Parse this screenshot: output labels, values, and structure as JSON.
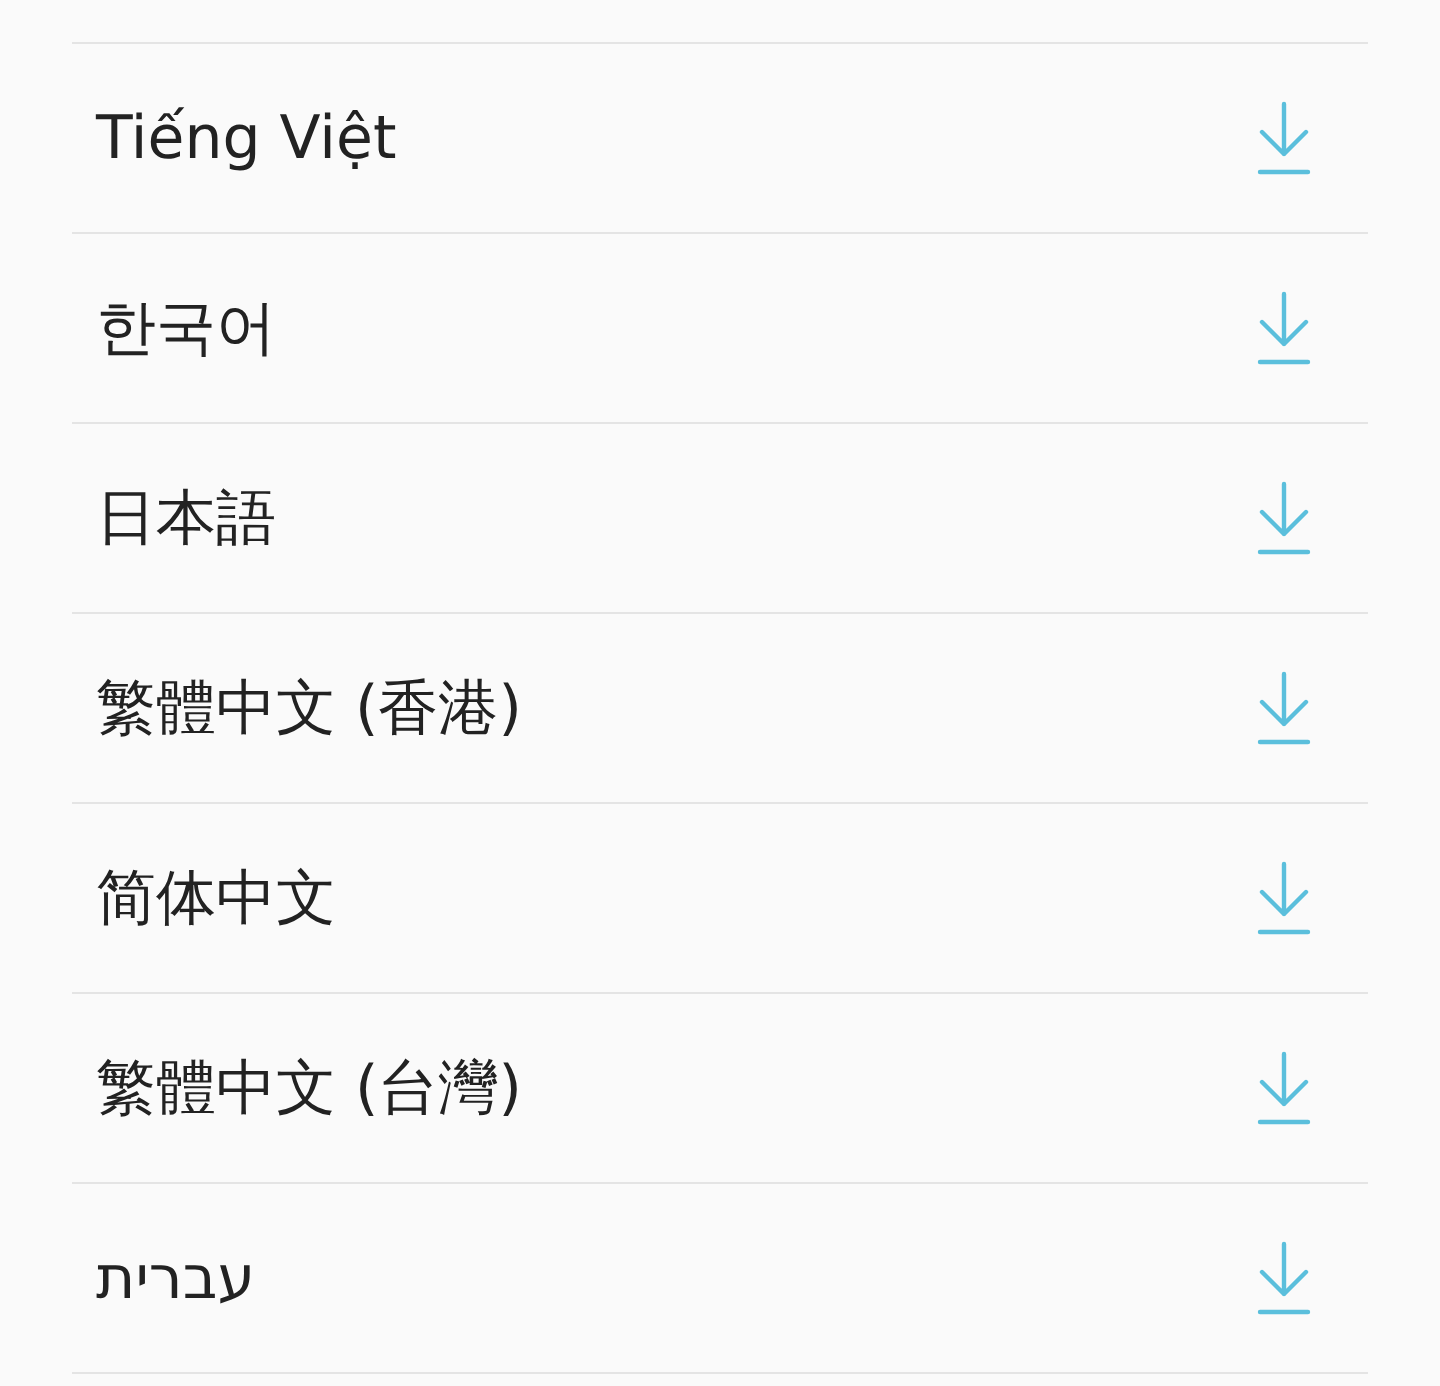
{
  "languages": [
    {
      "label": "Tiếng Việt"
    },
    {
      "label": "한국어"
    },
    {
      "label": "日本語"
    },
    {
      "label": "繁體中文 (香港)"
    },
    {
      "label": "简体中文"
    },
    {
      "label": "繁體中文 (台灣)"
    },
    {
      "label": "עברית"
    }
  ]
}
